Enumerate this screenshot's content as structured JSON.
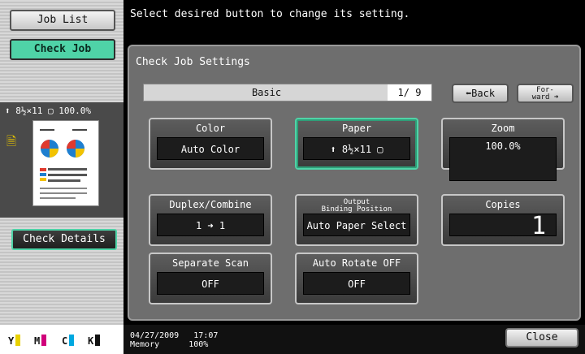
{
  "sidebar": {
    "job_list": "Job List",
    "check_job": "Check Job",
    "thumb_info": "⬆ 8½×11 ▢   100.0%",
    "check_details": "Check Details",
    "toner": [
      {
        "label": "Y",
        "color": "#e8d000"
      },
      {
        "label": "M",
        "color": "#d0007a"
      },
      {
        "label": "C",
        "color": "#00a8e0"
      },
      {
        "label": "K",
        "color": "#111111"
      }
    ]
  },
  "header": {
    "message": "Select desired button to change its setting."
  },
  "panel": {
    "title": "Check Job Settings",
    "tab_label": "Basic",
    "page": "1/ 9",
    "back": "⬅Back",
    "forward": "For-\nward ➜"
  },
  "buttons": {
    "color": {
      "title": "Color",
      "value": "Auto Color"
    },
    "paper": {
      "title": "Paper",
      "value": "⬆ 8½×11 ▢"
    },
    "zoom": {
      "title": "Zoom",
      "value": "100.0%"
    },
    "duplex": {
      "title": "Duplex/Combine",
      "value": "1 ➜ 1"
    },
    "output": {
      "title": "Output\nBinding Position",
      "value": "Auto Paper Select"
    },
    "copies": {
      "title": "Copies",
      "value": "1"
    },
    "separate_scan": {
      "title": "Separate Scan",
      "value": "OFF"
    },
    "auto_rotate": {
      "title": "Auto Rotate OFF",
      "value": "OFF"
    }
  },
  "status": {
    "date": "04/27/2009",
    "time": "17:07",
    "memory_label": "Memory",
    "memory_value": "100%"
  },
  "close": "Close"
}
